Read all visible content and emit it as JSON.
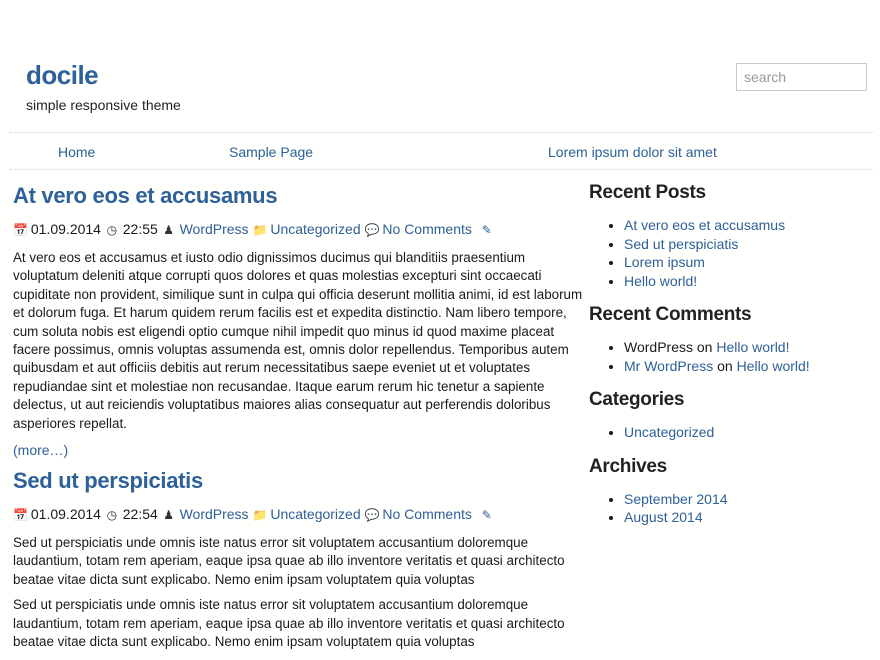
{
  "site": {
    "title": "docile",
    "description": "simple responsive theme"
  },
  "search": {
    "placeholder": "search"
  },
  "nav": {
    "items": [
      {
        "label": "Home"
      },
      {
        "label": "Sample Page"
      },
      {
        "label": "Lorem ipsum dolor sit amet"
      }
    ]
  },
  "posts": [
    {
      "title": "At vero eos et accusamus",
      "date": "01.09.2014",
      "time": "22:55",
      "author": "WordPress",
      "category": "Uncategorized",
      "comments": "No Comments",
      "paragraphs": [
        "At vero eos et accusamus et iusto odio dignissimos ducimus qui blanditiis praesentium voluptatum deleniti atque corrupti quos dolores et quas molestias excepturi sint occaecati cupiditate non provident, similique sunt in culpa qui officia deserunt mollitia animi, id est laborum et dolorum fuga. Et harum quidem rerum facilis est et expedita distinctio. Nam libero tempore, cum soluta nobis est eligendi optio cumque nihil impedit quo minus id quod maxime placeat facere possimus, omnis voluptas assumenda est, omnis dolor repellendus. Temporibus autem quibusdam et aut officiis debitis aut rerum necessitatibus saepe eveniet ut et voluptates repudiandae sint et molestiae non recusandae. Itaque earum rerum hic tenetur a sapiente delectus, ut aut reiciendis voluptatibus maiores alias consequatur aut perferendis doloribus asperiores repellat."
      ],
      "more": "(more…)"
    },
    {
      "title": "Sed ut perspiciatis",
      "date": "01.09.2014",
      "time": "22:54",
      "author": "WordPress",
      "category": "Uncategorized",
      "comments": "No Comments",
      "paragraphs": [
        "Sed ut perspiciatis unde omnis iste natus error sit voluptatem accusantium doloremque laudantium, totam rem aperiam, eaque ipsa quae ab illo inventore veritatis et quasi architecto beatae vitae dicta sunt explicabo. Nemo enim ipsam voluptatem quia voluptas",
        "Sed ut perspiciatis unde omnis iste natus error sit voluptatem accusantium doloremque laudantium, totam rem aperiam, eaque ipsa quae ab illo inventore veritatis et quasi architecto beatae vitae dicta sunt explicabo. Nemo enim ipsam voluptatem quia voluptas"
      ]
    }
  ],
  "sidebar": {
    "recent_posts": {
      "title": "Recent Posts",
      "items": [
        "At vero eos et accusamus",
        "Sed ut perspiciatis",
        "Lorem ipsum",
        "Hello world!"
      ]
    },
    "recent_comments": {
      "title": "Recent Comments",
      "items": [
        {
          "author": "WordPress",
          "on": "on",
          "post": "Hello world!"
        },
        {
          "author": "Mr WordPress",
          "on": "on",
          "post": "Hello world!"
        }
      ]
    },
    "categories": {
      "title": "Categories",
      "items": [
        "Uncategorized"
      ]
    },
    "archives": {
      "title": "Archives",
      "items": [
        "September 2014",
        "August 2014"
      ]
    }
  },
  "icons": {
    "date": "calendar-icon",
    "time": "clock-icon",
    "author": "user-icon",
    "category": "folder-icon",
    "comments": "comments-icon",
    "edit": "edit-icon"
  },
  "colors": {
    "link": "#2e6099",
    "text": "#1a1a1a"
  }
}
